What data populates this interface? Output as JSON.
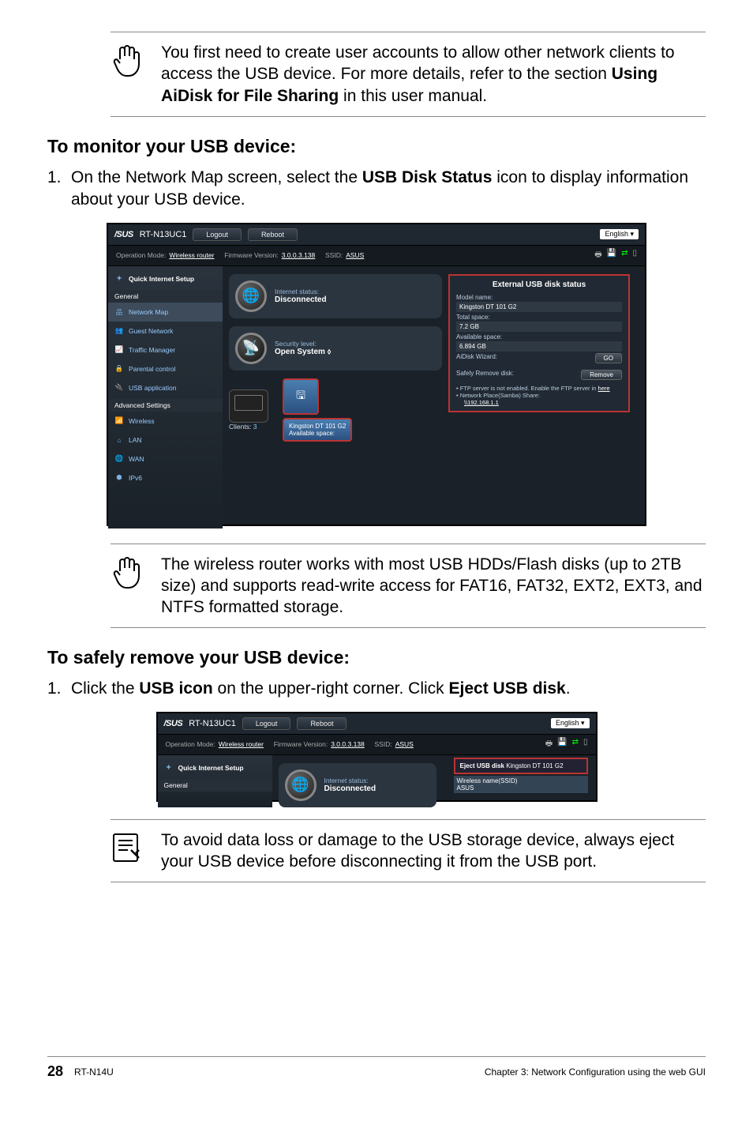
{
  "notes": {
    "accounts": "You first need to create user accounts to allow other network clients to access the USB device. For more details, refer to the section ",
    "accounts_bold": "Using AiDisk for File Sharing",
    "accounts_tail": " in this user manual.",
    "compat": "The wireless router works with most USB HDDs/Flash disks (up to 2TB size) and supports read-write access for FAT16, FAT32, EXT2, EXT3, and NTFS formatted storage.",
    "dataloss": "To avoid data loss or damage to the USB storage device, always eject your USB device before disconnecting it from the USB port."
  },
  "headings": {
    "monitor": "To monitor your USB device:",
    "safely_remove": "To safely remove your USB device:"
  },
  "steps": {
    "monitor_1_pre": "On the Network Map screen, select the ",
    "monitor_1_bold": "USB Disk Status",
    "monitor_1_post": " icon to display information about your USB device.",
    "eject_1_pre": "Click the ",
    "eject_1_bold": "USB icon",
    "eject_1_mid": " on the upper-right corner. Click ",
    "eject_1_bold2": "Eject USB disk",
    "eject_1_post": "."
  },
  "router": {
    "logo": "/SUS",
    "model": "RT-N13UC1",
    "logout": "Logout",
    "reboot": "Reboot",
    "lang": "English",
    "info_mode_label": "Operation Mode: ",
    "info_mode_val": "Wireless router",
    "info_fw_label": "Firmware Version: ",
    "info_fw_val": "3.0.0.3.138",
    "info_ssid_label": "SSID: ",
    "info_ssid_val": "ASUS",
    "sidebar": {
      "quick": "Quick Internet Setup",
      "general_hdr": "General",
      "items_general": [
        "Network Map",
        "Guest Network",
        "Traffic Manager",
        "Parental control",
        "USB application"
      ],
      "adv_hdr": "Advanced Settings",
      "items_adv": [
        "Wireless",
        "LAN",
        "WAN",
        "IPv6"
      ]
    },
    "center": {
      "internet_label": "Internet status:",
      "internet_val": "Disconnected",
      "sec_label": "Security level:",
      "sec_val": "Open System ⬨",
      "clients_label": "Clients: ",
      "clients_val": "3",
      "usb_info_name": "Kingston DT 101 G2",
      "usb_info_avail_label": "Available space:"
    },
    "panel": {
      "title": "External USB disk status",
      "model_label": "Model name:",
      "model_val": "Kingston DT 101 G2",
      "total_label": "Total space:",
      "total_val": "7.2 GB",
      "avail_label": "Available space:",
      "avail_val": "6.894 GB",
      "aidisk_label": "AiDisk Wizard:",
      "aidisk_btn": "GO",
      "safely_label": "Safely Remove disk:",
      "safely_btn": "Remove",
      "bul1_a": "FTP server is not enabled. Enable the FTP server in ",
      "bul1_b": "here",
      "bul2": "Network Place(Samba) Share:",
      "bul2_path": "\\\\192.168.1.1"
    },
    "eject_popup_pre": "Eject USB disk ",
    "eject_popup_model": "Kingston DT 101 G2",
    "wname_label": "Wireless name(SSID)",
    "wname_val": "ASUS"
  },
  "footer": {
    "page": "28",
    "model": "RT-N14U",
    "chapter": "Chapter 3: Network Configuration using the web GUI"
  }
}
